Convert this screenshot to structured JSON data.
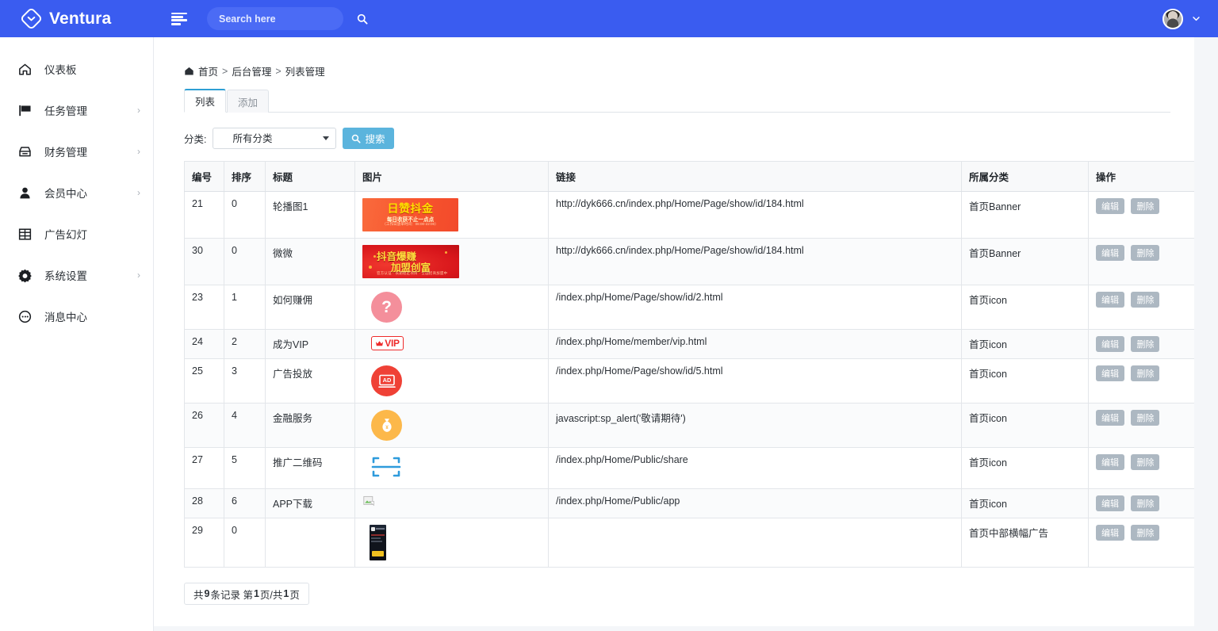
{
  "brand": {
    "name": "Ventura",
    "logo_icon": "diamond-chevron-logo"
  },
  "topbar": {
    "menu_toggle_icon": "hamburger-icon",
    "search": {
      "placeholder": "Search here",
      "value": "",
      "icon": "search-icon"
    },
    "avatar_icon": "user-avatar",
    "dropdown_icon": "chevron-down-icon"
  },
  "sidebar": {
    "items": [
      {
        "label": "仪表板",
        "icon": "home-icon",
        "has_children": false
      },
      {
        "label": "任务管理",
        "icon": "flag-icon",
        "has_children": true,
        "caret": "›"
      },
      {
        "label": "财务管理",
        "icon": "drive-icon",
        "has_children": true,
        "caret": "›"
      },
      {
        "label": "会员中心",
        "icon": "user-icon",
        "has_children": true,
        "caret": "›"
      },
      {
        "label": "广告幻灯",
        "icon": "grid-icon",
        "has_children": false
      },
      {
        "label": "系统设置",
        "icon": "gear-icon",
        "has_children": true,
        "caret": "›"
      },
      {
        "label": "消息中心",
        "icon": "chat-icon",
        "has_children": false
      }
    ]
  },
  "breadcrumb": {
    "home_icon": "home-icon",
    "items": [
      "首页",
      "后台管理",
      "列表管理"
    ],
    "separator": ">"
  },
  "tabs": [
    {
      "label": "列表",
      "active": true
    },
    {
      "label": "添加",
      "active": false
    }
  ],
  "filter": {
    "label": "分类:",
    "select_value": "所有分类",
    "select_options": [
      "所有分类"
    ],
    "search_button": "搜索",
    "search_icon": "search-icon"
  },
  "table": {
    "headers": [
      "编号",
      "排序",
      "标题",
      "图片",
      "链接",
      "所属分类",
      "操作"
    ],
    "rows": [
      {
        "id": "21",
        "order": "0",
        "title": "轮播图1",
        "thumb": "banner-ad-orange",
        "thumb_text": {
          "main": "日赞抖金",
          "sub": "每日收获不止一点点",
          "sub2": "（工作日放单时间：08:00-22:00）"
        },
        "link": "http://dyk666.cn/index.php/Home/Page/show/id/184.html",
        "category": "首页Banner",
        "actions": [
          "编辑",
          "删除"
        ]
      },
      {
        "id": "30",
        "order": "0",
        "title": "微微",
        "thumb": "banner-ad-red",
        "thumb_text": {
          "main": "抖音爆赚",
          "sub": "加盟创富",
          "sub2": "官方认证 · 长期稳定项目 · 全国招商加盟中"
        },
        "link": "http://dyk666.cn/index.php/Home/Page/show/id/184.html",
        "category": "首页Banner",
        "actions": [
          "编辑",
          "删除"
        ]
      },
      {
        "id": "23",
        "order": "1",
        "title": "如何赚佣",
        "thumb": "question-mark-icon",
        "link": "/index.php/Home/Page/show/id/2.html",
        "category": "首页icon",
        "actions": [
          "编辑",
          "删除"
        ]
      },
      {
        "id": "24",
        "order": "2",
        "title": "成为VIP",
        "thumb": "vip-badge-icon",
        "thumb_text": {
          "main": "VIP"
        },
        "link": "/index.php/Home/member/vip.html",
        "category": "首页icon",
        "actions": [
          "编辑",
          "删除"
        ]
      },
      {
        "id": "25",
        "order": "3",
        "title": "广告投放",
        "thumb": "ad-monitor-icon",
        "thumb_text": {
          "main": "AD"
        },
        "link": "/index.php/Home/Page/show/id/5.html",
        "category": "首页icon",
        "actions": [
          "编辑",
          "删除"
        ]
      },
      {
        "id": "26",
        "order": "4",
        "title": "金融服务",
        "thumb": "money-bag-icon",
        "link": "javascript:sp_alert('敬请期待')",
        "category": "首页icon",
        "actions": [
          "编辑",
          "删除"
        ]
      },
      {
        "id": "27",
        "order": "5",
        "title": "推广二维码",
        "thumb": "qr-scan-icon",
        "link": "/index.php/Home/Public/share",
        "category": "首页icon",
        "actions": [
          "编辑",
          "删除"
        ]
      },
      {
        "id": "28",
        "order": "6",
        "title": "APP下载",
        "thumb": "broken-image-icon",
        "link": "/index.php/Home/Public/app",
        "category": "首页icon",
        "actions": [
          "编辑",
          "删除"
        ]
      },
      {
        "id": "29",
        "order": "0",
        "title": "",
        "thumb": "phone-screenshot",
        "link": "",
        "category": "首页中部横幅广告",
        "actions": [
          "编辑",
          "删除"
        ]
      }
    ]
  },
  "pagination": {
    "prefix": "共",
    "total": "9",
    "middle": "条记录 第",
    "page": "1",
    "middle2": "页/共",
    "pages": "1",
    "suffix": "页"
  },
  "colors": {
    "brand_blue": "#3a5cf0",
    "search_button": "#5bb4dd",
    "tab_accent": "#2f9fd4",
    "action_button": "#adb8c2",
    "page_bg": "#f4f6f9"
  }
}
